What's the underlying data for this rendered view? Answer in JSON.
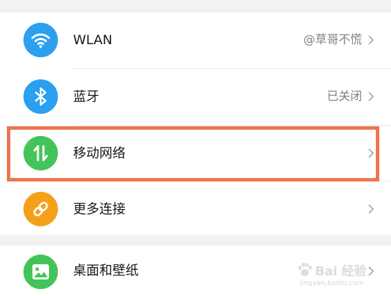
{
  "settings": {
    "items": [
      {
        "label": "WLAN",
        "value": "@草哥不慌",
        "icon": "wifi-icon",
        "color": "#2b9ff0"
      },
      {
        "label": "蓝牙",
        "value": "已关闭",
        "icon": "bluetooth-icon",
        "color": "#2b9ff0"
      },
      {
        "label": "移动网络",
        "value": "",
        "icon": "mobile-data-icon",
        "color": "#43c45a"
      },
      {
        "label": "更多连接",
        "value": "",
        "icon": "link-icon",
        "color": "#f5a01b"
      },
      {
        "label": "桌面和壁纸",
        "value": "",
        "icon": "image-icon",
        "color": "#43c45a"
      }
    ]
  },
  "highlight": {
    "color": "#ee7450",
    "target": "移动网络"
  },
  "watermark": {
    "text": "Bai 经验",
    "url": "jingyan.baidu.com"
  }
}
